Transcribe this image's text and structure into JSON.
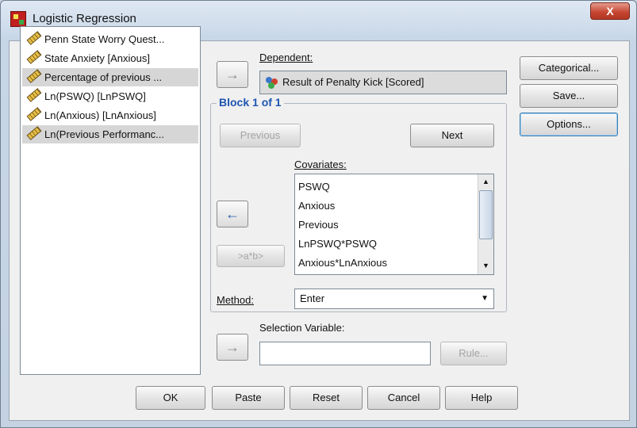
{
  "window": {
    "title": "Logistic Regression",
    "close_label": "X"
  },
  "variables": [
    {
      "label": "Penn State Worry Quest...",
      "selected": false
    },
    {
      "label": "State Anxiety [Anxious]",
      "selected": false
    },
    {
      "label": "Percentage of previous ...",
      "selected": true
    },
    {
      "label": "Ln(PSWQ) [LnPSWQ]",
      "selected": false
    },
    {
      "label": "Ln(Anxious) [LnAnxious]",
      "selected": false
    },
    {
      "label": "Ln(Previous Performanc...",
      "selected": true
    }
  ],
  "dependent": {
    "label": "Dependent:",
    "value": "Result of Penalty Kick [Scored]"
  },
  "block": {
    "title": "Block 1 of 1",
    "previous_label": "Previous",
    "next_label": "Next"
  },
  "covariates": {
    "label": "Covariates:",
    "items": [
      "PSWQ",
      "Anxious",
      "Previous",
      "LnPSWQ*PSWQ",
      "Anxious*LnAnxious"
    ]
  },
  "interaction_button_label": ">a*b>",
  "method": {
    "label": "Method:",
    "value": "Enter"
  },
  "selection_variable": {
    "label": "Selection Variable:",
    "value": "",
    "rule_label": "Rule..."
  },
  "side_buttons": {
    "categorical": "Categorical...",
    "save": "Save...",
    "options": "Options..."
  },
  "footer_buttons": {
    "ok": "OK",
    "paste": "Paste",
    "reset": "Reset",
    "cancel": "Cancel",
    "help": "Help"
  },
  "icons": {
    "arrow_right": "→",
    "arrow_left": "←",
    "up": "▲",
    "down": "▼"
  }
}
